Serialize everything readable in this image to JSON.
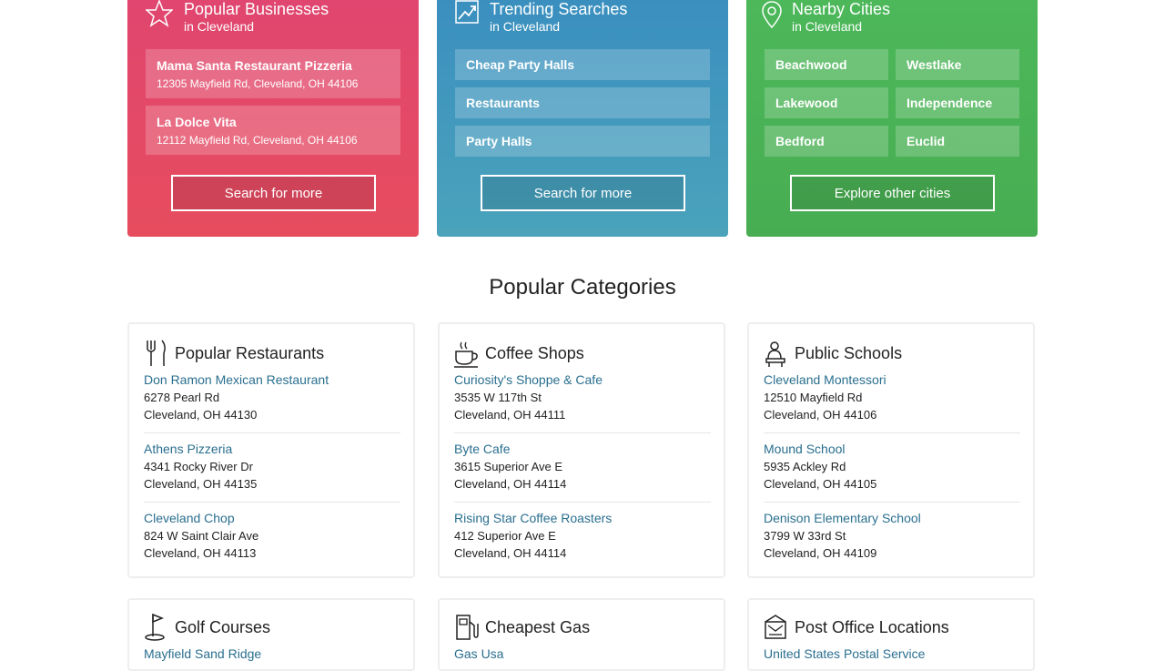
{
  "promos": {
    "popular": {
      "title": "Popular Businesses",
      "subtitle": "in Cleveland",
      "businesses": [
        {
          "name": "Mama Santa Restaurant Pizzeria",
          "address": "12305 Mayfield Rd, Cleveland, OH 44106"
        },
        {
          "name": "La Dolce Vita",
          "address": "12112 Mayfield Rd, Cleveland, OH 44106"
        }
      ],
      "button": "Search for more"
    },
    "trending": {
      "title": "Trending Searches",
      "subtitle": "in Cleveland",
      "items": [
        "Cheap Party Halls",
        "Restaurants",
        "Party Halls"
      ],
      "button": "Search for more"
    },
    "nearby": {
      "title": "Nearby Cities",
      "subtitle": "in Cleveland",
      "cities": [
        "Beachwood",
        "Westlake",
        "Lakewood",
        "Independence",
        "Bedford",
        "Euclid"
      ],
      "button": "Explore other cities"
    }
  },
  "categories_title": "Popular Categories",
  "categories": [
    {
      "title": "Popular Restaurants",
      "icon": "fork-knife-icon",
      "places": [
        {
          "name": "Don Ramon Mexican Restaurant",
          "street": "6278 Pearl Rd",
          "city": "Cleveland, OH 44130"
        },
        {
          "name": "Athens Pizzeria",
          "street": "4341 Rocky River Dr",
          "city": "Cleveland, OH 44135"
        },
        {
          "name": "Cleveland Chop",
          "street": "824 W Saint Clair Ave",
          "city": "Cleveland, OH 44113"
        }
      ]
    },
    {
      "title": "Coffee Shops",
      "icon": "coffee-cup-icon",
      "places": [
        {
          "name": "Curiosity's Shoppe & Cafe",
          "street": "3535 W 117th St",
          "city": "Cleveland, OH 44111"
        },
        {
          "name": "Byte Cafe",
          "street": "3615 Superior Ave E",
          "city": "Cleveland, OH 44114"
        },
        {
          "name": "Rising Star Coffee Roasters",
          "street": "412 Superior Ave E",
          "city": "Cleveland, OH 44114"
        }
      ]
    },
    {
      "title": "Public Schools",
      "icon": "school-icon",
      "places": [
        {
          "name": "Cleveland Montessori",
          "street": "12510 Mayfield Rd",
          "city": "Cleveland, OH 44106"
        },
        {
          "name": "Mound School",
          "street": "5935 Ackley Rd",
          "city": "Cleveland, OH 44105"
        },
        {
          "name": "Denison Elementary School",
          "street": "3799 W 33rd St",
          "city": "Cleveland, OH 44109"
        }
      ]
    },
    {
      "title": "Golf Courses",
      "icon": "golf-flag-icon",
      "places": [
        {
          "name": "Mayfield Sand Ridge",
          "street": "",
          "city": ""
        }
      ]
    },
    {
      "title": "Cheapest Gas",
      "icon": "gas-pump-icon",
      "places": [
        {
          "name": "Gas Usa",
          "street": "",
          "city": ""
        }
      ]
    },
    {
      "title": "Post Office Locations",
      "icon": "post-office-icon",
      "places": [
        {
          "name": "United States Postal Service",
          "street": "",
          "city": ""
        }
      ]
    }
  ]
}
